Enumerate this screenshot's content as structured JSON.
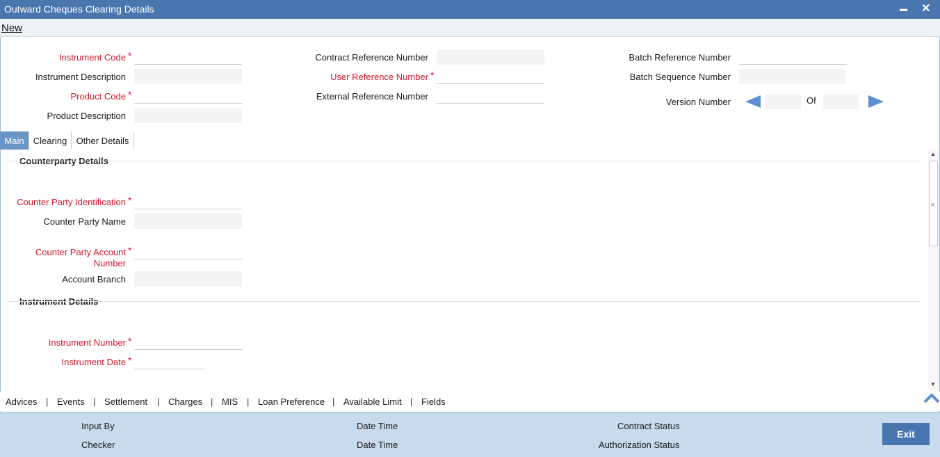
{
  "window": {
    "title": "Outward Cheques Clearing Details",
    "minimize_icon": "minimize-icon",
    "close_icon": "close-icon",
    "minimize_glyph": "▬",
    "close_glyph": "✕"
  },
  "menubar": {
    "new_label": "New"
  },
  "header": {
    "instrument_code": {
      "label": "Instrument Code",
      "value": ""
    },
    "instrument_description": {
      "label": "Instrument Description",
      "value": ""
    },
    "product_code": {
      "label": "Product Code",
      "value": ""
    },
    "product_description": {
      "label": "Product Description",
      "value": ""
    },
    "contract_reference_number": {
      "label": "Contract Reference Number",
      "value": ""
    },
    "user_reference_number": {
      "label": "User Reference Number",
      "value": ""
    },
    "external_reference_number": {
      "label": "External Reference Number",
      "value": ""
    },
    "batch_reference_number": {
      "label": "Batch Reference Number",
      "value": ""
    },
    "batch_sequence_number": {
      "label": "Batch Sequence Number",
      "value": ""
    },
    "version": {
      "label": "Version Number",
      "of_label": "Of",
      "current": "",
      "total": ""
    },
    "required_mark": "*"
  },
  "tabs": [
    {
      "label": "Main",
      "active": true
    },
    {
      "label": "Clearing",
      "active": false
    },
    {
      "label": "Other Details",
      "active": false
    }
  ],
  "main": {
    "counterparty_section": "Counterparty Details",
    "counter_party_identification": {
      "label": "Counter Party Identification",
      "value": ""
    },
    "counter_party_name": {
      "label": "Counter Party Name",
      "value": ""
    },
    "counter_party_account_number": {
      "label_line1": "Counter Party Account",
      "label_line2": "Number",
      "value": ""
    },
    "account_branch": {
      "label": "Account Branch",
      "value": ""
    },
    "instrument_section": "Instrument Details",
    "instrument_number": {
      "label": "Instrument Number",
      "value": ""
    },
    "instrument_date": {
      "label": "Instrument Date",
      "value": ""
    }
  },
  "actions": [
    "Advices",
    "Events",
    "Settlement",
    "Charges",
    "MIS",
    "Loan Preference",
    "Available Limit",
    "Fields"
  ],
  "action_separator": "|",
  "footer": {
    "input_by": "Input By",
    "date_time_1": "Date Time",
    "contract_status": "Contract Status",
    "checker": "Checker",
    "date_time_2": "Date Time",
    "authorization_status": "Authorization Status",
    "exit_label": "Exit"
  },
  "colors": {
    "title_bar": "#4a76b0",
    "required": "#d6182b",
    "active_tab": "#6b95c7",
    "footer": "#c7dbed"
  }
}
